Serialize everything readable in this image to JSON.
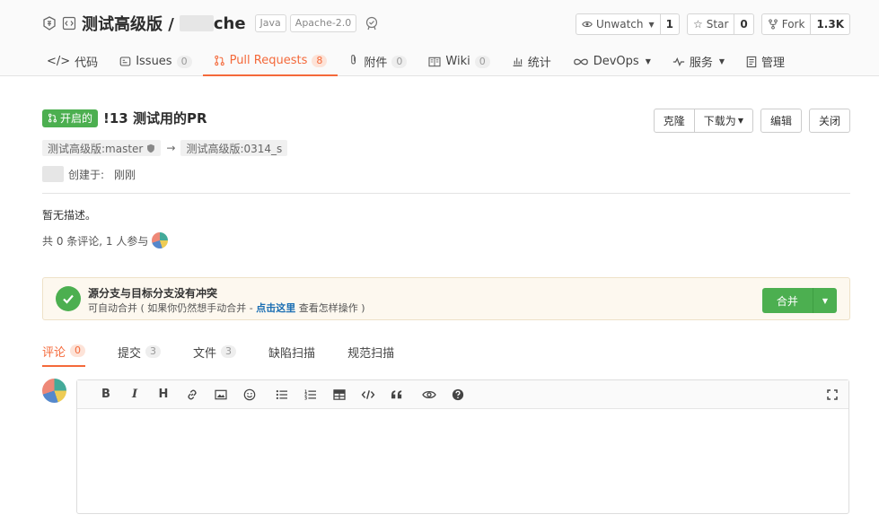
{
  "repo": {
    "name_prefix": "测试高级版 / ",
    "name_suffix": "che",
    "tags": [
      "Java",
      "Apache-2.0"
    ]
  },
  "actions": {
    "watch": {
      "label": "Unwatch",
      "count": "1"
    },
    "star": {
      "label": "Star",
      "count": "0"
    },
    "fork": {
      "label": "Fork",
      "count": "1.3K"
    }
  },
  "tabs": [
    {
      "label": "代码",
      "icon": "code-icon"
    },
    {
      "label": "Issues",
      "count": "0",
      "icon": "issues-icon"
    },
    {
      "label": "Pull Requests",
      "count": "8",
      "icon": "pull-request-icon"
    },
    {
      "label": "附件",
      "count": "0",
      "icon": "paperclip-icon"
    },
    {
      "label": "Wiki",
      "count": "0",
      "icon": "book-icon"
    },
    {
      "label": "统计",
      "icon": "bar-chart-icon"
    },
    {
      "label": "DevOps",
      "icon": "infinity-icon"
    },
    {
      "label": "服务",
      "icon": "pulse-icon"
    },
    {
      "label": "管理",
      "icon": "settings-doc-icon"
    }
  ],
  "pr": {
    "status": "开启的",
    "title": "!13 测试用的PR",
    "buttons": {
      "clone": "克隆",
      "download": "下载为",
      "edit": "编辑",
      "close": "关闭"
    },
    "source_branch": "测试高级版:master",
    "target_branch": "测试高级版:0314_s",
    "arrow": "→",
    "created_label": "创建于:",
    "created_time": "刚刚",
    "description": "暂无描述。",
    "participants": "共 0 条评论, 1 人参与"
  },
  "merge": {
    "title": "源分支与目标分支没有冲突",
    "sub_before": "可自动合并 ( 如果你仍然想手动合并 - ",
    "sub_link": "点击这里",
    "sub_after": " 查看怎样操作 )",
    "button": "合并"
  },
  "sub_tabs": [
    {
      "label": "评论",
      "count": "0"
    },
    {
      "label": "提交",
      "count": "3"
    },
    {
      "label": "文件",
      "count": "3"
    },
    {
      "label": "缺陷扫描"
    },
    {
      "label": "规范扫描"
    }
  ],
  "toolbar": {
    "bold": "B",
    "italic": "I",
    "heading": "H"
  },
  "colors": {
    "accent": "#f4693a",
    "green": "#4caf50",
    "link": "#1a6eb3"
  }
}
